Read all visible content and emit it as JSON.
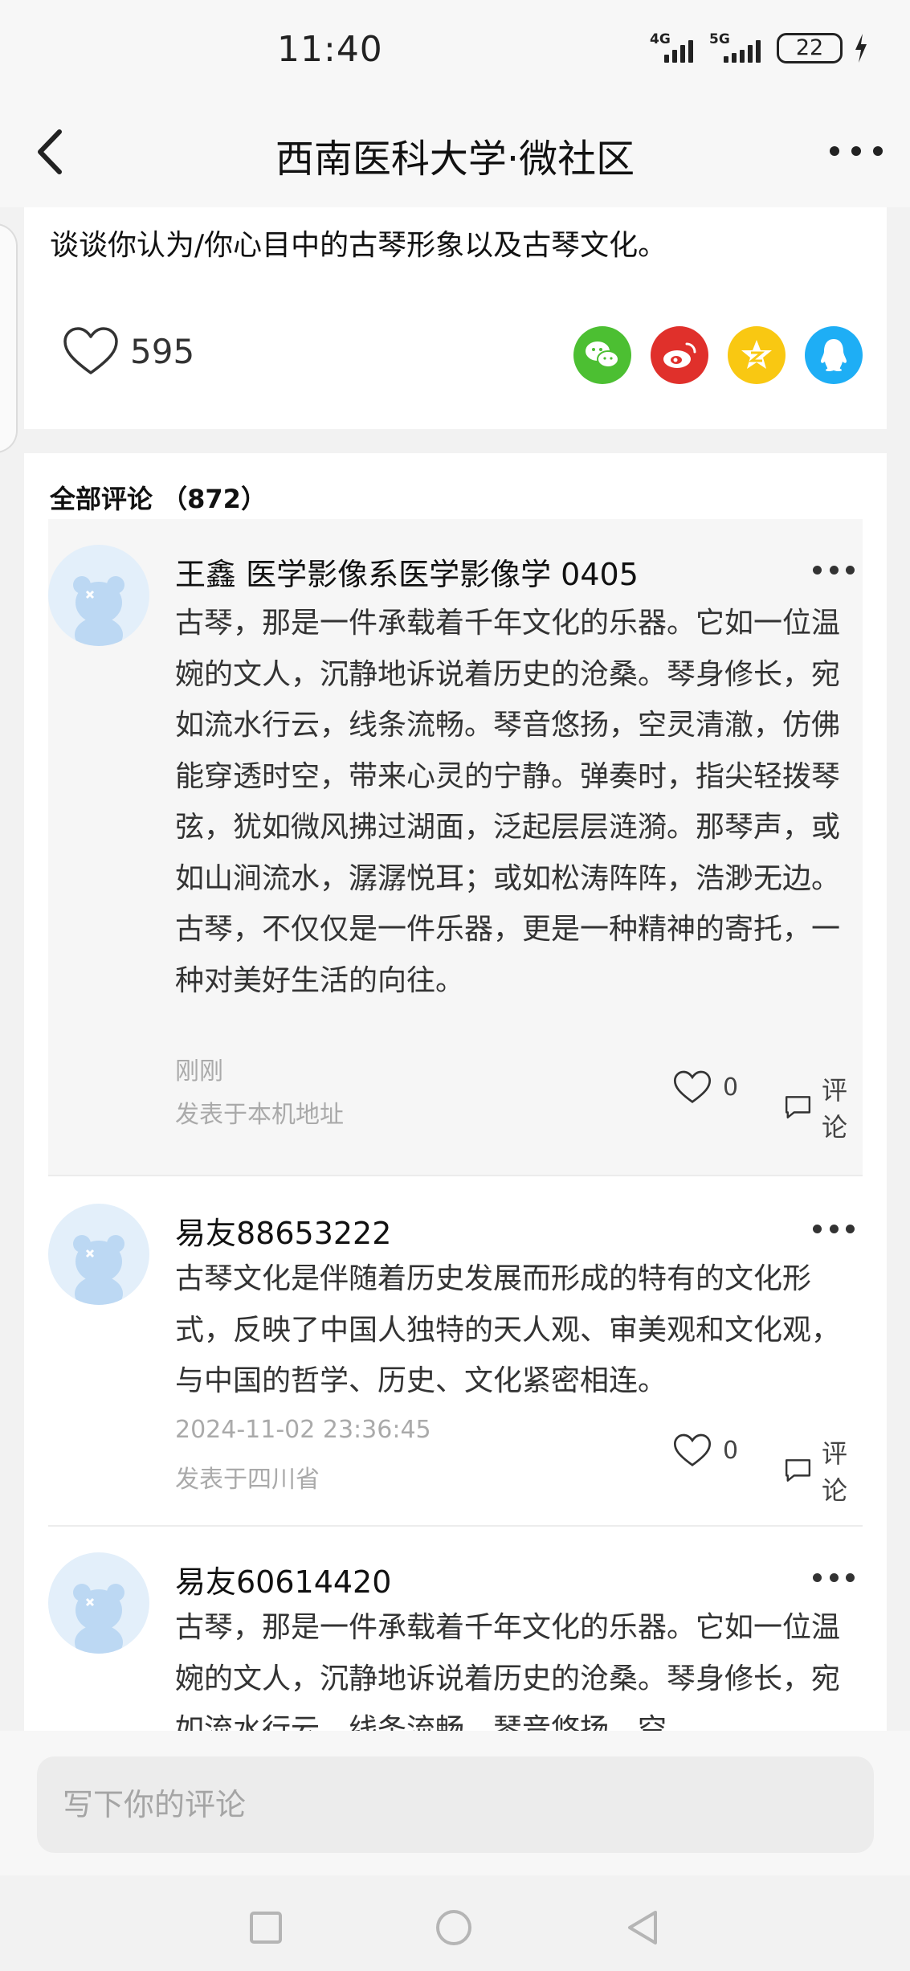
{
  "status_bar": {
    "time": "11:40",
    "signal_1_label": "4G",
    "signal_2_label": "5G",
    "battery": "22"
  },
  "header": {
    "title": "西南医科大学·微社区",
    "back_icon": "chevron-left-icon",
    "more_icon": "more-dots-icon"
  },
  "post": {
    "text": "谈谈你认为/你心目中的古琴形象以及古琴文化。",
    "like_count": "595",
    "share_icons": [
      "wechat-icon",
      "weibo-icon",
      "qzone-icon",
      "qq-icon"
    ],
    "colors": {
      "wechat": "#4cbf32",
      "weibo": "#e0302b",
      "qzone": "#f9c812",
      "qq": "#1eaef5"
    }
  },
  "comments": {
    "header": "全部评论 （872）",
    "items": [
      {
        "author": "王鑫 医学影像系医学影像学 0405",
        "body": "古琴，那是一件承载着千年文化的乐器。它如一位温婉的文人，沉静地诉说着历史的沧桑。琴身修长，宛如流水行云，线条流畅。琴音悠扬，空灵清澈，仿佛能穿透时空，带来心灵的宁静。弹奏时，指尖轻拨琴弦，犹如微风拂过湖面，泛起层层涟漪。那琴声，或如山涧流水，潺潺悦耳；或如松涛阵阵，浩渺无边。古琴，不仅仅是一件乐器，更是一种精神的寄托，一种对美好生活的向往。",
        "time": "刚刚",
        "location": "发表于本机地址",
        "likes": "0",
        "reply_label": "评论"
      },
      {
        "author": "易友88653222",
        "body": "古琴文化是伴随着历史发展而形成的特有的文化形式，反映了中国人独特的天人观、审美观和文化观，与中国的哲学、历史、文化紧密相连。",
        "time": "2024-11-02 23:36:45",
        "location": "发表于四川省",
        "likes": "0",
        "reply_label": "评论"
      },
      {
        "author": "易友60614420",
        "body": "古琴，那是一件承载着千年文化的乐器。它如一位温婉的文人，沉静地诉说着历史的沧桑。琴身修长，宛如流水行云，线条流畅。琴音悠扬，空"
      }
    ]
  },
  "input": {
    "placeholder": "写下你的评论"
  },
  "system_nav": [
    "square-icon",
    "circle-icon",
    "back-triangle-icon"
  ]
}
